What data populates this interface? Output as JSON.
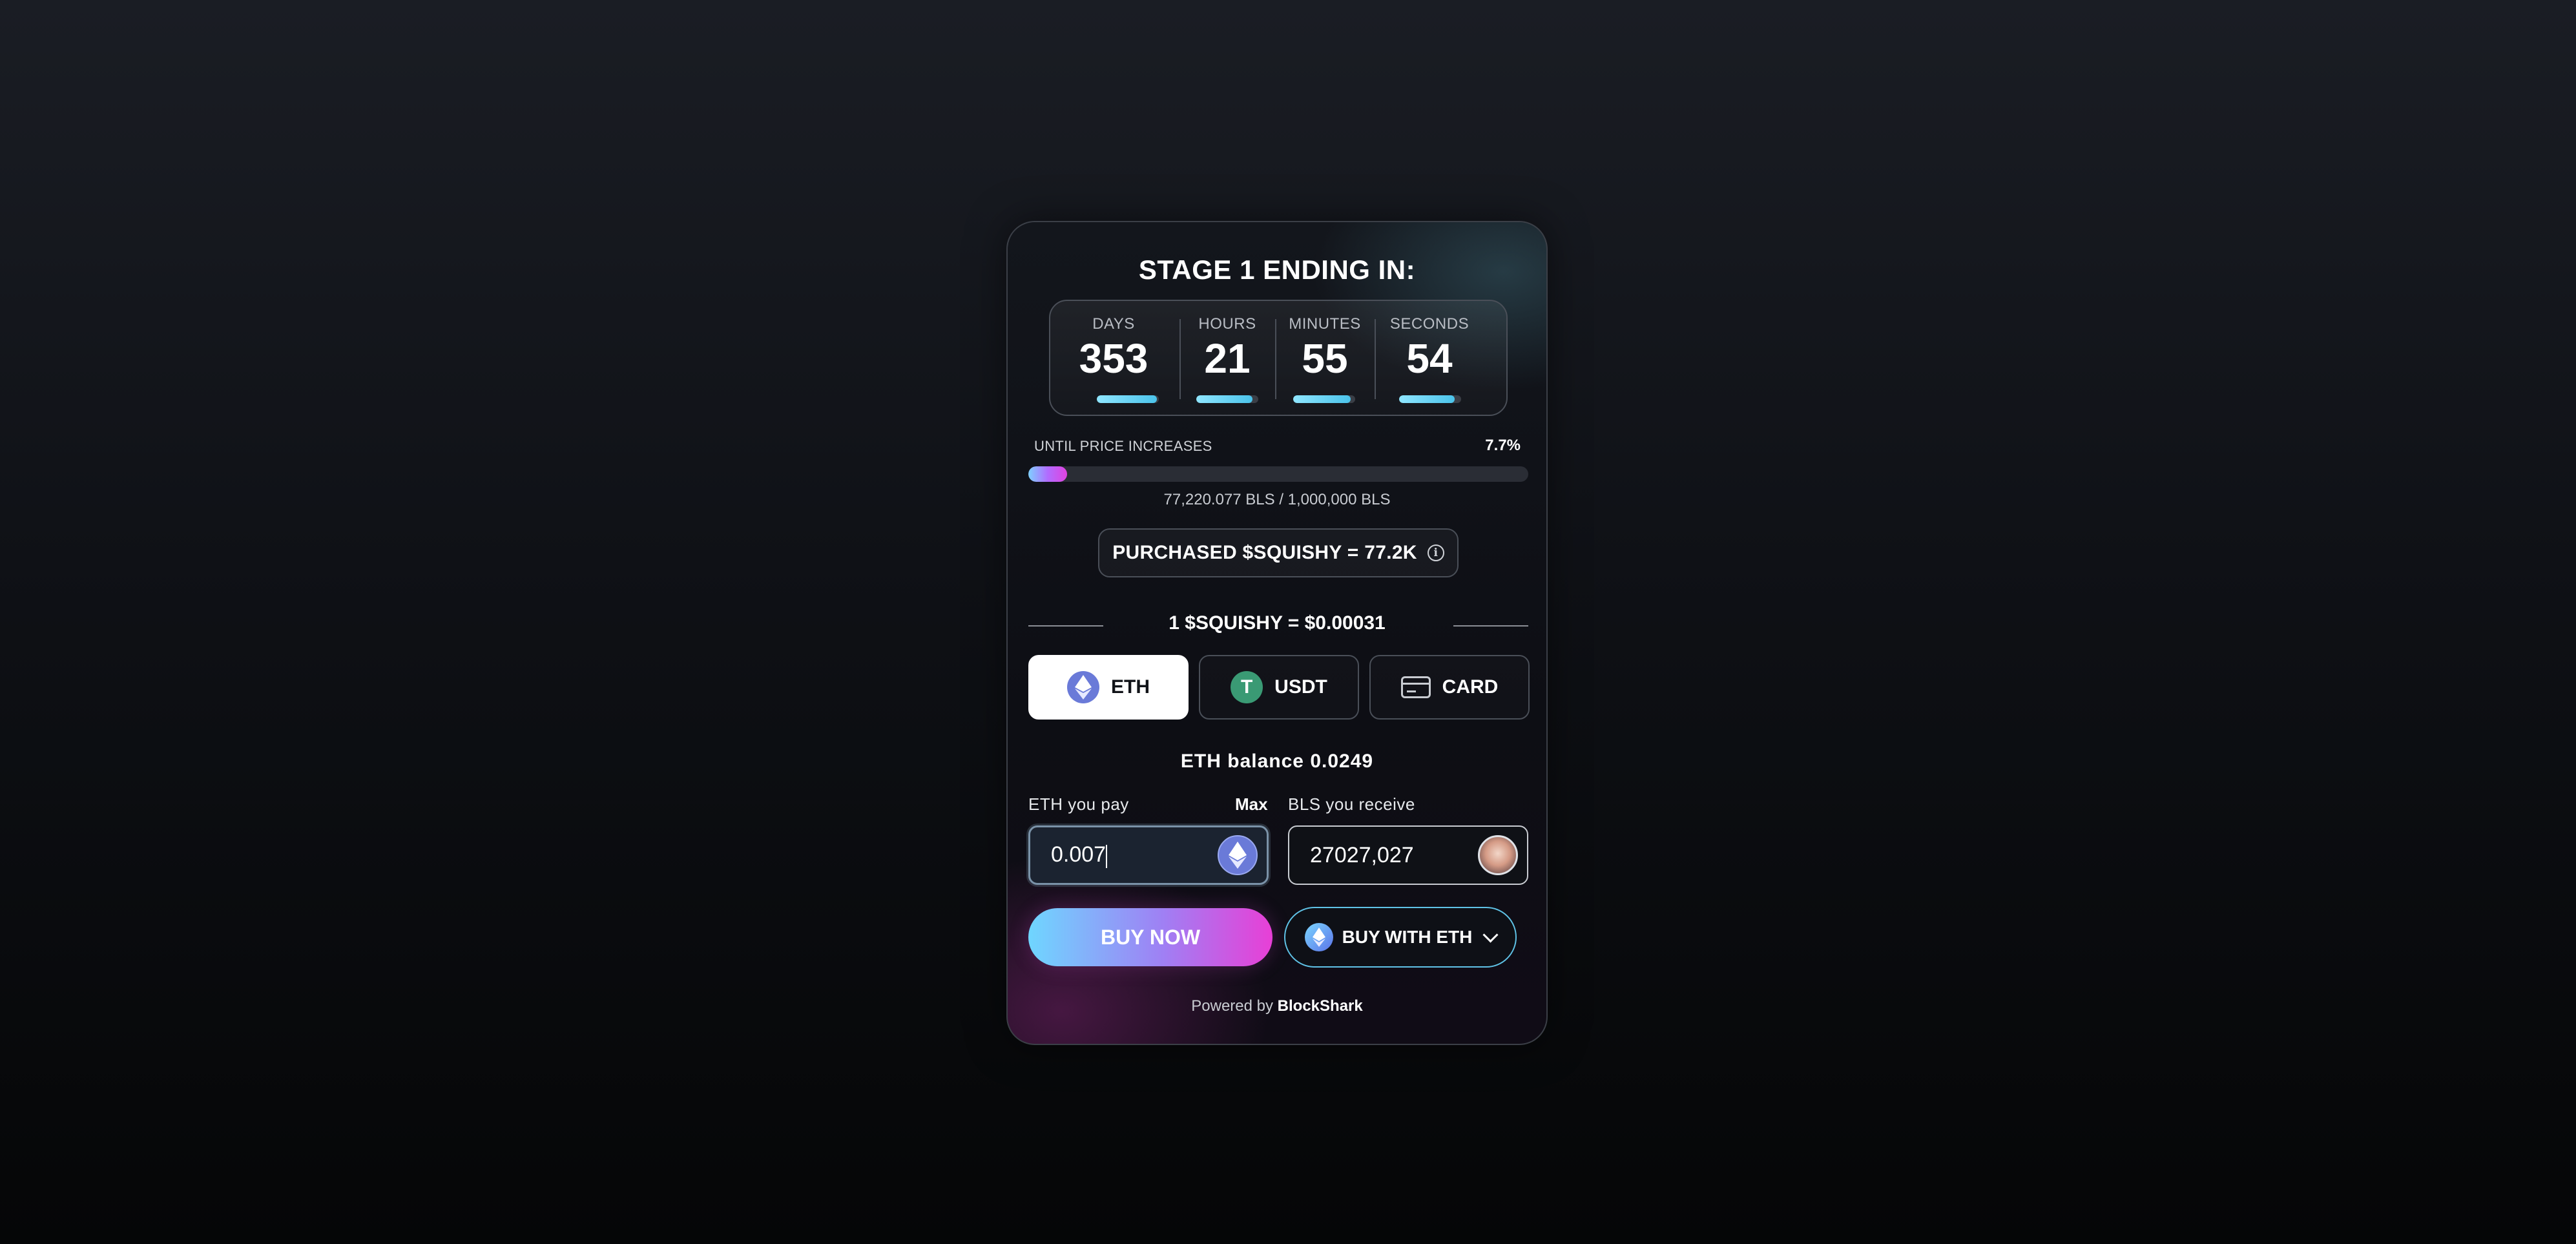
{
  "stage": {
    "title": "STAGE 1 ENDING IN:"
  },
  "countdown": {
    "units": [
      {
        "label": "DAYS",
        "value": "353",
        "progress": 0.97
      },
      {
        "label": "HOURS",
        "value": "21",
        "progress": 0.91
      },
      {
        "label": "MINUTES",
        "value": "55",
        "progress": 0.93
      },
      {
        "label": "SECONDS",
        "value": "54",
        "progress": 0.9
      }
    ]
  },
  "sale_progress": {
    "label": "UNTIL PRICE INCREASES",
    "percent_text": "7.7%",
    "fraction": 0.077,
    "supply_text": "77,220.077 BLS / 1,000,000 BLS"
  },
  "purchased": {
    "text": "PURCHASED $SQUISHY = 77.2K",
    "info_icon": "i"
  },
  "rate": {
    "text": "1 $SQUISHY = $0.00031"
  },
  "payment_tabs": [
    {
      "label": "ETH",
      "icon": "ethereum-icon",
      "active": true
    },
    {
      "label": "USDT",
      "icon": "tether-icon",
      "active": false
    },
    {
      "label": "CARD",
      "icon": "credit-card-icon",
      "active": false
    }
  ],
  "usdt_glyph": "T",
  "balance": {
    "text": "ETH balance 0.0249"
  },
  "pay_field": {
    "label": "ETH you pay",
    "max_label": "Max",
    "value": "0.007"
  },
  "receive_field": {
    "label": "BLS you receive",
    "value": "27027,027"
  },
  "actions": {
    "buy_now": "BUY NOW",
    "buy_with": "BUY WITH ETH"
  },
  "footer": {
    "prefix": "Powered by",
    "brand": "BlockShark"
  },
  "colors": {
    "accent_cyan": "#6fd6ff",
    "accent_magenta": "#e83fd6",
    "eth": "#6a7ad8",
    "usdt": "#3a9a74"
  }
}
